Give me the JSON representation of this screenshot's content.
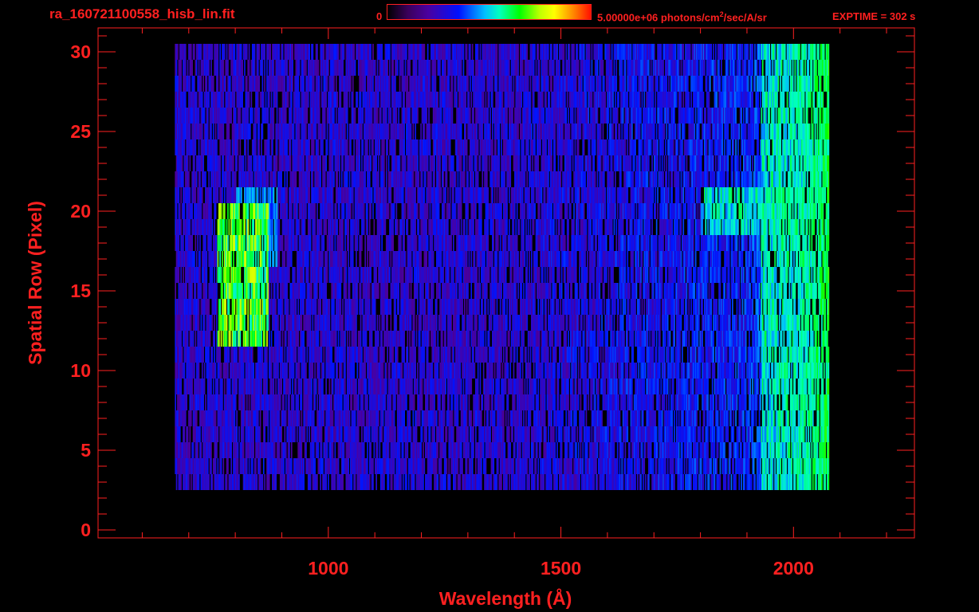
{
  "header": {
    "title": "ra_160721100558_hisb_lin.fit",
    "colorbar_min": "0",
    "colorbar_max_prefix": "5.00000e+06 photons/cm",
    "colorbar_max_sup": "2",
    "colorbar_max_suffix": "/sec/A/sr",
    "exptime": "EXPTIME = 302 s"
  },
  "colors": {
    "axis": "#ff2020",
    "background": "#000000"
  },
  "chart_data": {
    "type": "heatmap",
    "title": "ra_160721100558_hisb_lin.fit",
    "xlabel": "Wavelength (Å)",
    "ylabel": "Spatial Row (Pixel)",
    "xlim": [
      505,
      2260
    ],
    "ylim": [
      -0.5,
      31.5
    ],
    "xticks": [
      1000,
      1500,
      2000
    ],
    "xtick_labels": [
      "1000",
      "1500",
      "2000"
    ],
    "yticks": [
      0,
      5,
      10,
      15,
      20,
      25,
      30
    ],
    "ytick_labels": [
      "0",
      "5",
      "10",
      "15",
      "20",
      "25",
      "30"
    ],
    "colorbar": {
      "min": 0,
      "max": 5000000,
      "units": "photons/cm^2/sec/A/sr",
      "colormap": "rainbow"
    },
    "data_extent": {
      "x_range": [
        670,
        2075
      ],
      "rows": [
        3,
        30
      ]
    },
    "features": [
      {
        "x_range": [
          760,
          870
        ],
        "rows": [
          12,
          20
        ],
        "level": 0.7
      },
      {
        "x_range": [
          800,
          890
        ],
        "rows": [
          17,
          21
        ],
        "level": 0.45
      },
      {
        "x_range": [
          1800,
          2075
        ],
        "rows": [
          19,
          21
        ],
        "level": 0.55
      },
      {
        "x_range": [
          1930,
          2075
        ],
        "rows": [
          3,
          30
        ],
        "level": 0.55
      }
    ],
    "grid": false
  }
}
